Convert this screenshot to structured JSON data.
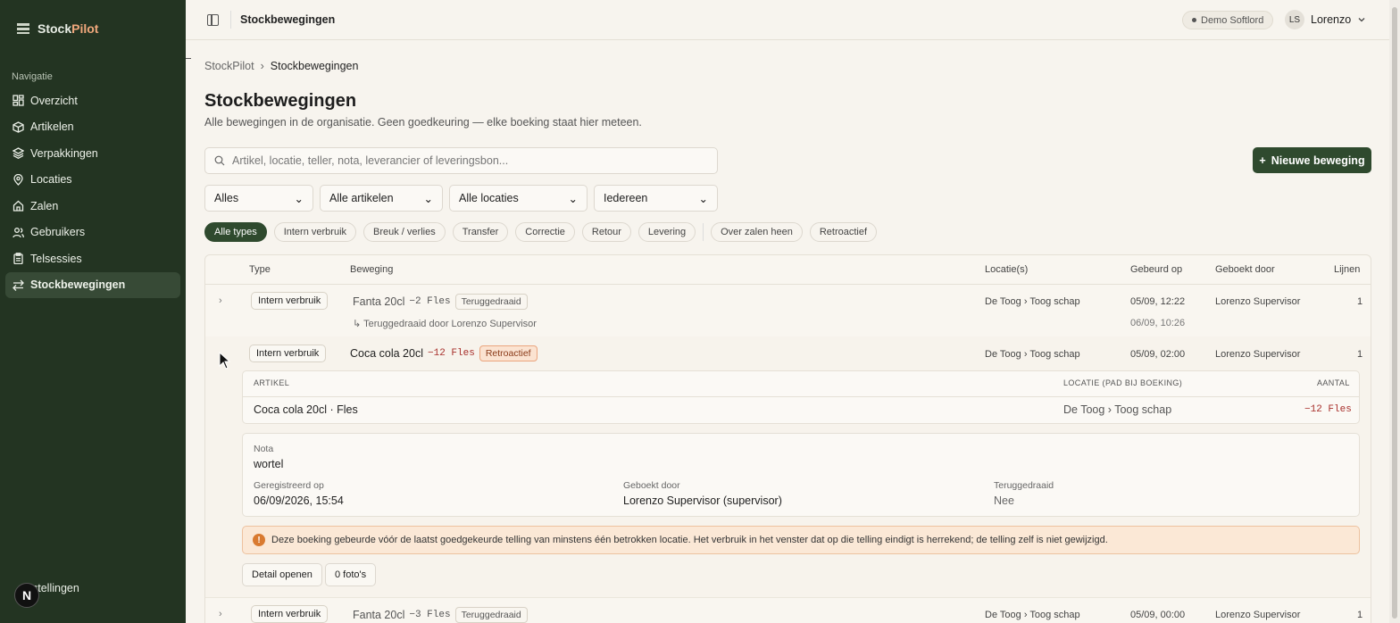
{
  "brand": {
    "name_a": "Stock",
    "name_b": "Pilot"
  },
  "sidebar": {
    "heading": "Navigatie",
    "items": [
      {
        "label": "Overzicht",
        "icon": "dashboard-icon"
      },
      {
        "label": "Artikelen",
        "icon": "box-icon"
      },
      {
        "label": "Verpakkingen",
        "icon": "layers-icon"
      },
      {
        "label": "Locaties",
        "icon": "map-pin-icon"
      },
      {
        "label": "Zalen",
        "icon": "home-icon"
      },
      {
        "label": "Gebruikers",
        "icon": "users-icon"
      },
      {
        "label": "Telsessies",
        "icon": "clipboard-icon"
      },
      {
        "label": "Stockbewegingen",
        "icon": "arrows-icon",
        "active": true
      }
    ],
    "settings_label": "stellingen",
    "badge": "N"
  },
  "topbar": {
    "title": "Stockbewegingen",
    "demo": "Demo Softlord",
    "user_initials": "LS",
    "user_name": "Lorenzo"
  },
  "breadcrumb": {
    "root": "StockPilot",
    "current": "Stockbewegingen"
  },
  "page": {
    "title": "Stockbewegingen",
    "subtitle": "Alle bewegingen in de organisatie. Geen goedkeuring — elke boeking staat hier meteen.",
    "search_placeholder": "Artikel, locatie, teller, nota, leverancier of leveringsbon...",
    "new_button": "Nieuwe beweging"
  },
  "filters": {
    "type": "Alles",
    "artikelen": "Alle artikelen",
    "locaties": "Alle locaties",
    "gebruiker": "Iedereen"
  },
  "chips": [
    "Alle types",
    "Intern verbruik",
    "Breuk / verlies",
    "Transfer",
    "Correctie",
    "Retour",
    "Levering"
  ],
  "chips_extra": [
    "Over zalen heen",
    "Retroactief"
  ],
  "table": {
    "headers": {
      "type": "Type",
      "beweging": "Beweging",
      "locaties": "Locatie(s)",
      "gebeurd": "Gebeurd op",
      "geboekt": "Geboekt door",
      "lijnen": "Lijnen"
    },
    "rows": [
      {
        "type": "Intern verbruik",
        "artikel": "Fanta 20cl",
        "qty": "−2 Fles",
        "tag": "Teruggedraaid",
        "locatie": "De Toog › Toog schap",
        "gebeurd": "05/09, 12:22",
        "geboekt": "Lorenzo Supervisor",
        "lijnen": "1",
        "sub": "↳ Teruggedraaid door Lorenzo Supervisor",
        "sub_date": "06/09, 10:26"
      },
      {
        "type": "Intern verbruik",
        "artikel": "Coca cola 20cl",
        "qty": "−12 Fles",
        "tag": "Retroactief",
        "locatie": "De Toog › Toog schap",
        "gebeurd": "05/09, 02:00",
        "geboekt": "Lorenzo Supervisor",
        "lijnen": "1"
      },
      {
        "type": "Intern verbruik",
        "artikel": "Fanta 20cl",
        "qty": "−3 Fles",
        "tag": "Teruggedraaid",
        "locatie": "De Toog › Toog schap",
        "gebeurd": "05/09, 00:00",
        "geboekt": "Lorenzo Supervisor",
        "lijnen": "1"
      }
    ]
  },
  "detail": {
    "headers": {
      "artikel": "Artikel",
      "locatie": "Locatie (pad bij boeking)",
      "aantal": "Aantal"
    },
    "line": {
      "artikel": "Coca cola 20cl · Fles",
      "locatie": "De Toog › Toog schap",
      "aantal": "−12 Fles"
    },
    "nota_label": "Nota",
    "nota": "wortel",
    "registered_label": "Geregistreerd op",
    "registered": "06/09/2026, 15:54",
    "booked_label": "Geboekt door",
    "booked": "Lorenzo Supervisor (supervisor)",
    "reverted_label": "Teruggedraaid",
    "reverted": "Nee",
    "warning": "Deze boeking gebeurde vóór de laatst goedgekeurde telling van minstens één betrokken locatie. Het verbruik in het venster dat op die telling eindigt is herrekend; de telling zelf is niet gewijzigd.",
    "open_button": "Detail openen",
    "photos_button": "0 foto's"
  },
  "colors": {
    "sidebar": "#233422",
    "accent": "#2f4a2e",
    "brand_accent": "#f0a87c",
    "negative": "#a8302c",
    "warning_bg": "#fbe8d6"
  }
}
